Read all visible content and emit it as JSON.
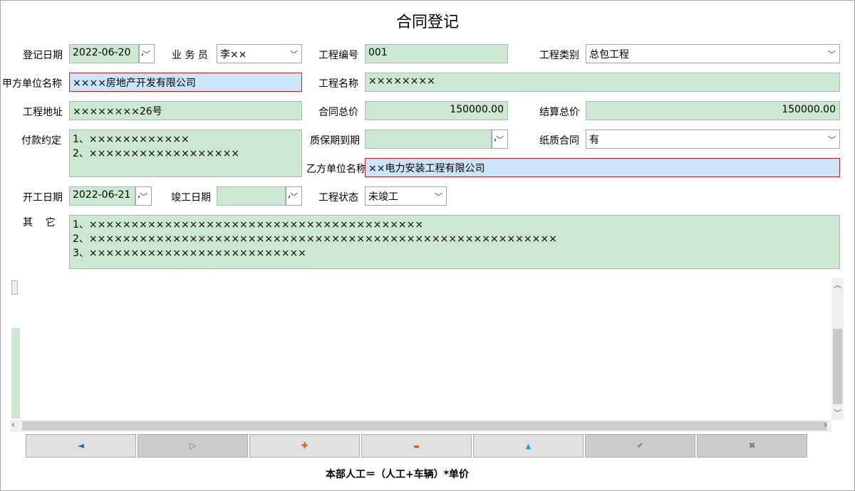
{
  "title": "合同登记",
  "labels": {
    "reg_date": "登记日期",
    "salesman": "业 务 员",
    "project_no": "工程编号",
    "project_type": "工程类别",
    "party_a": "甲方单位名称",
    "project_name": "工程名称",
    "address": "工程地址",
    "contract_total": "合同总价",
    "settle_total": "结算总价",
    "payment": "付款约定",
    "warranty": "质保期到期",
    "paper": "纸质合同",
    "party_b": "乙方单位名称",
    "start": "开工日期",
    "finish": "竣工日期",
    "status": "工程状态",
    "other": "其    它"
  },
  "values": {
    "reg_date": "2022-06-20",
    "salesman": "李××",
    "project_no": "001",
    "project_type": "总包工程",
    "party_a": "××××房地产开发有限公司",
    "project_name": "××××××××",
    "address": "××××××××26号",
    "contract_total": "150000.00",
    "settle_total": "150000.00",
    "payment": [
      "1、××××××××××××",
      "2、××××××××××××××××××"
    ],
    "warranty": "",
    "paper": "有",
    "party_b": "××电力安装工程有限公司",
    "start": "2022-06-21",
    "finish": "",
    "status": "未竣工",
    "other": [
      "1、××××××××××××××××××××××××××××××××××××××××",
      "2、××××××××××××××××××××××××××××××××××××××××××××××××××××××××",
      "3、××××××××××××××××××××××××××"
    ]
  },
  "nav_buttons": [
    {
      "name": "prev-record-button",
      "glyph": "◄",
      "color": "#1a6fc9",
      "enabled": true
    },
    {
      "name": "next-record-button",
      "glyph": "▷",
      "color": "#7d7d7d",
      "enabled": false
    },
    {
      "name": "add-record-button",
      "glyph": "✚",
      "color": "#e06010",
      "enabled": true
    },
    {
      "name": "delete-record-button",
      "glyph": "▬",
      "color": "#e06010",
      "enabled": true
    },
    {
      "name": "edit-record-button",
      "glyph": "▲",
      "color": "#2a9ed0",
      "enabled": true
    },
    {
      "name": "save-record-button",
      "glyph": "✔",
      "color": "#7d7d7d",
      "enabled": false
    },
    {
      "name": "cancel-record-button",
      "glyph": "✖",
      "color": "#7d7d7d",
      "enabled": false
    }
  ],
  "formula": "本部人工＝（人工+车辆）*单价"
}
